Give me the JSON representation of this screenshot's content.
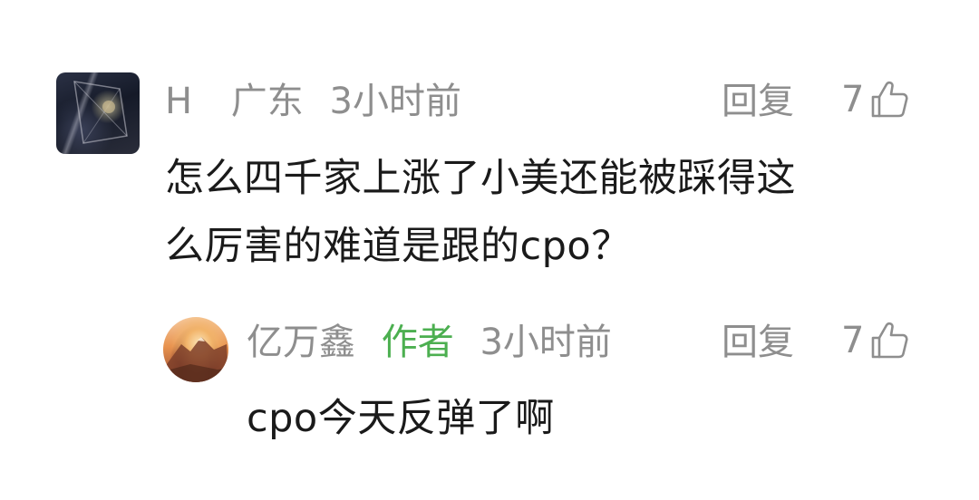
{
  "comments": [
    {
      "user": "H",
      "location": "广东",
      "time": "3小时前",
      "reply_label": "回复",
      "likes": "7",
      "text_lines": [
        "怎么四千家上涨了小美还能被踩得这",
        "么厉害的难道是跟的cpo？"
      ]
    }
  ],
  "reply": {
    "user": "亿万鑫",
    "author_tag": "作者",
    "time": "3小时前",
    "reply_label": "回复",
    "likes": "7",
    "text": "cpo今天反弹了啊"
  },
  "colors": {
    "meta_gray": "#8e8e8e",
    "author_green": "#4caf50",
    "body_text": "#1a1a1a"
  },
  "icons": {
    "like": "thumbs-up-outline"
  }
}
